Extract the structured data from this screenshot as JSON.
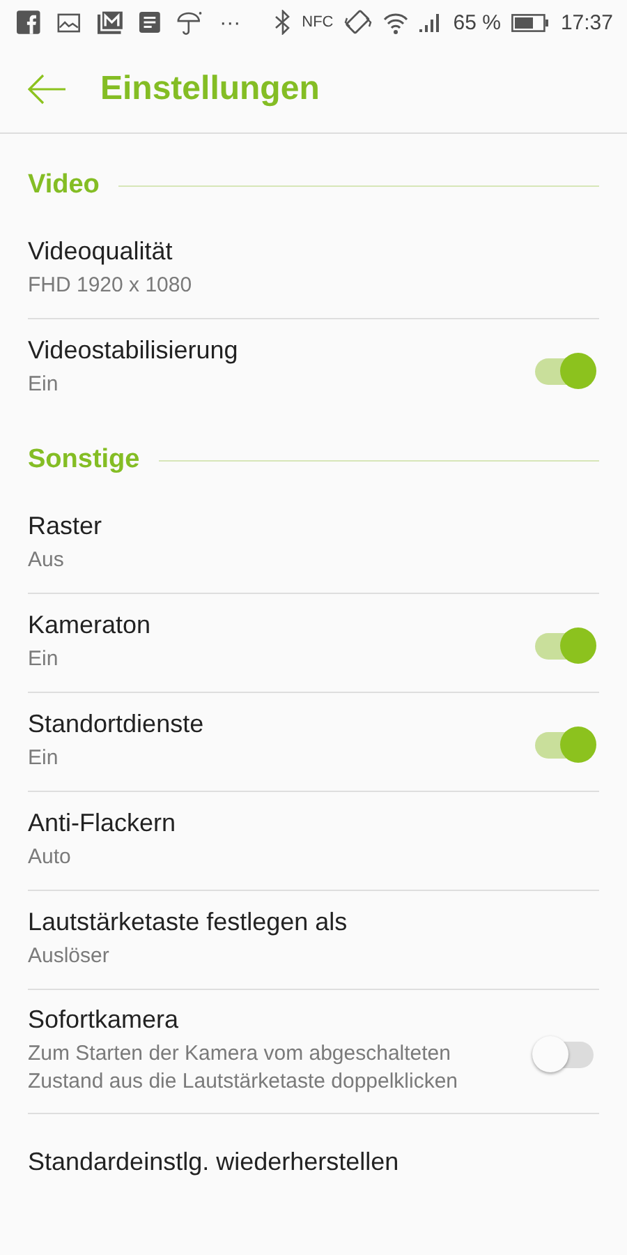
{
  "status_bar": {
    "more": "···",
    "nfc": "NFC",
    "battery_percent": "65 %",
    "time": "17:37"
  },
  "app_bar": {
    "title": "Einstellungen"
  },
  "sections": [
    {
      "title": "Video",
      "rows": [
        {
          "kind": "plain",
          "title": "Videoqualität",
          "summary": "FHD   1920 x 1080"
        },
        {
          "kind": "toggle",
          "title": "Videostabilisierung",
          "summary": "Ein",
          "on": true
        }
      ]
    },
    {
      "title": "Sonstige",
      "rows": [
        {
          "kind": "plain",
          "title": "Raster",
          "summary": "Aus"
        },
        {
          "kind": "toggle",
          "title": "Kameraton",
          "summary": "Ein",
          "on": true
        },
        {
          "kind": "toggle",
          "title": "Standortdienste",
          "summary": "Ein",
          "on": true
        },
        {
          "kind": "plain",
          "title": "Anti-Flackern",
          "summary": "Auto"
        },
        {
          "kind": "plain",
          "title": "Lautstärketaste festlegen als",
          "summary": "Auslöser"
        },
        {
          "kind": "toggle",
          "title": "Sofortkamera",
          "summary": "Zum Starten der Kamera vom abgeschalteten Zustand aus die Lautstärketaste doppelklicken",
          "on": false
        },
        {
          "kind": "plain",
          "title": "Standardeinstlg. wiederherstellen"
        }
      ]
    }
  ]
}
